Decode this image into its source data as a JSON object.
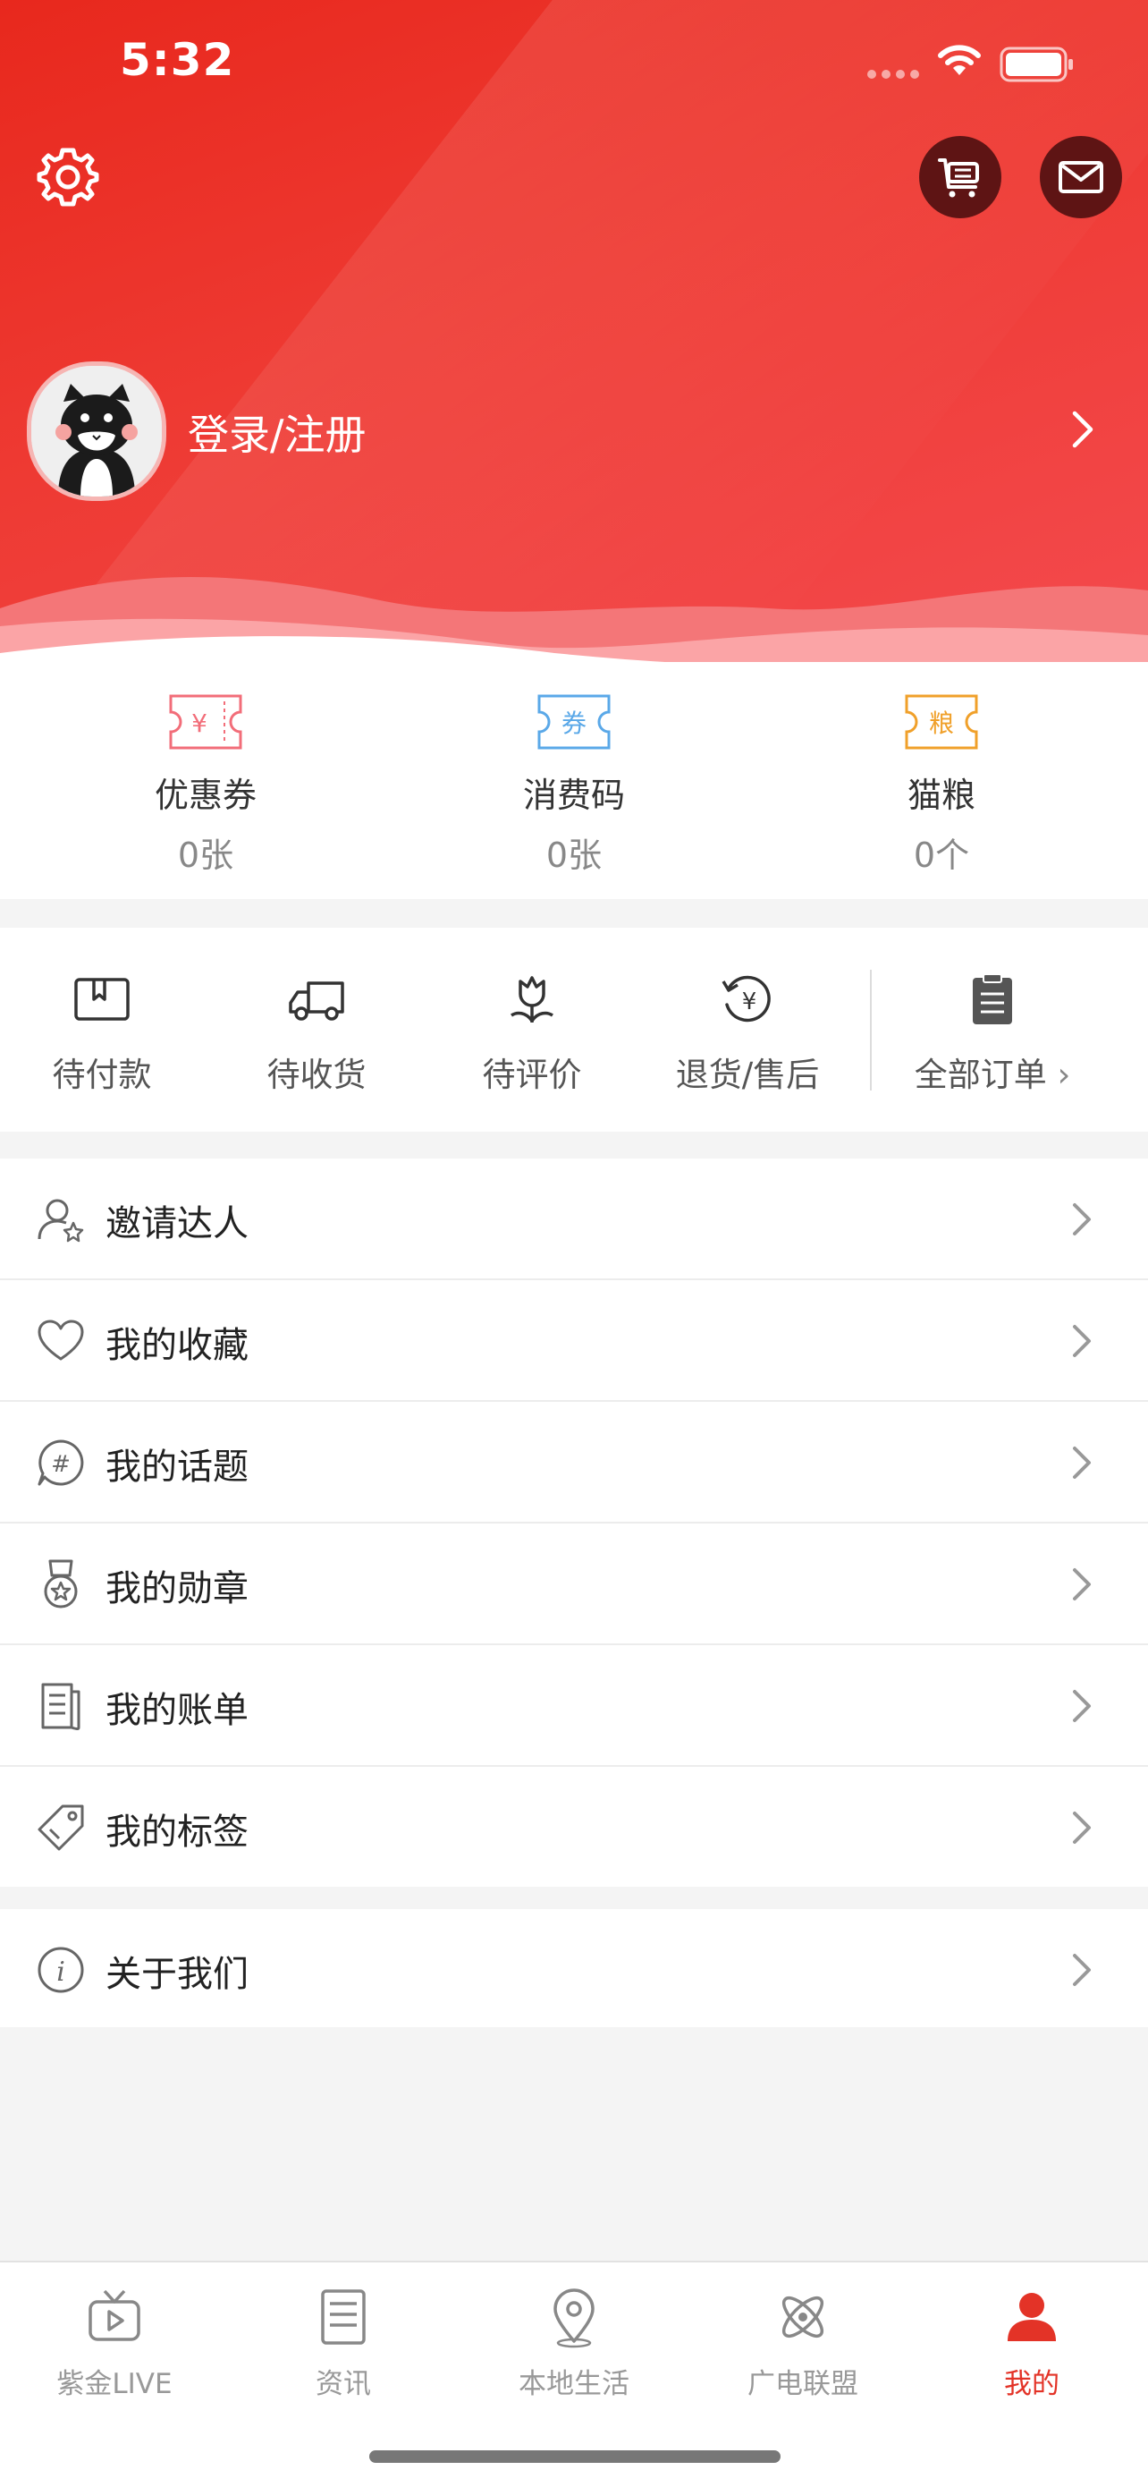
{
  "status": {
    "time": "5:32"
  },
  "header": {
    "login_label": "登录/注册"
  },
  "stats": [
    {
      "label": "优惠券",
      "value": "0张",
      "icon": "coupon-icon",
      "icon_text": "¥",
      "color": "#f26d79"
    },
    {
      "label": "消费码",
      "value": "0张",
      "icon": "voucher-icon",
      "icon_text": "券",
      "color": "#5aa8e8"
    },
    {
      "label": "猫粮",
      "value": "0个",
      "icon": "cat-food-icon",
      "icon_text": "粮",
      "color": "#f0a02a"
    }
  ],
  "orders": [
    {
      "label": "待付款",
      "icon": "wallet-icon"
    },
    {
      "label": "待收货",
      "icon": "truck-icon"
    },
    {
      "label": "待评价",
      "icon": "flower-icon"
    },
    {
      "label": "退货/售后",
      "icon": "refund-icon"
    },
    {
      "label": "全部订单",
      "icon": "clipboard-icon"
    }
  ],
  "menu": [
    {
      "label": "邀请达人",
      "icon": "invite-user-icon"
    },
    {
      "label": "我的收藏",
      "icon": "heart-icon"
    },
    {
      "label": "我的话题",
      "icon": "topic-hash-icon"
    },
    {
      "label": "我的勋章",
      "icon": "medal-icon"
    },
    {
      "label": "我的账单",
      "icon": "bill-icon"
    },
    {
      "label": "我的标签",
      "icon": "tag-icon"
    }
  ],
  "menu2": [
    {
      "label": "关于我们",
      "icon": "info-icon"
    }
  ],
  "tabbar": [
    {
      "label": "紫金LIVE",
      "icon": "tv-icon"
    },
    {
      "label": "资讯",
      "icon": "news-list-icon"
    },
    {
      "label": "本地生活",
      "icon": "location-pin-icon"
    },
    {
      "label": "广电联盟",
      "icon": "atom-icon"
    },
    {
      "label": "我的",
      "icon": "user-icon",
      "active": true
    }
  ],
  "colors": {
    "brand_red": "#e8281d",
    "active_tab": "#e33327"
  }
}
